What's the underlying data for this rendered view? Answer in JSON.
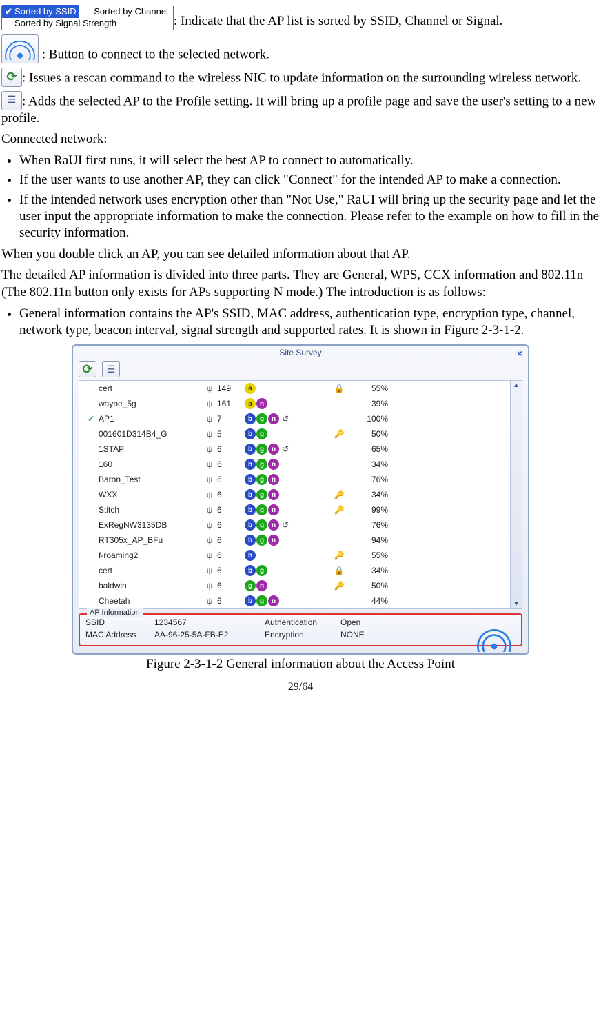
{
  "sort_dropdown": {
    "items": [
      "Sorted by SSID",
      "Sorted by Channel",
      "Sorted by Signal Strength"
    ],
    "selected_index": 0
  },
  "desc": {
    "sort": ": Indicate that the AP list is sorted by SSID, Channel or Signal.",
    "connect": " : Button to connect to the selected network.",
    "rescan": ": Issues a rescan command to the wireless NIC to update information on the surrounding wireless network.",
    "addprof": ": Adds the selected AP to the Profile setting. It will bring up a profile page and save the user's setting to a new profile."
  },
  "connected_heading": "Connected network:",
  "connected_bullets": [
    "When RaUI first runs, it will select the best AP to connect to automatically.",
    "If the user wants to use another AP, they can click \"Connect\" for the intended AP to make a connection.",
    "If the intended network uses encryption other than \"Not Use,\" RaUI will bring up the security page and let the user input the appropriate information to make the connection. Please refer to the example on how to fill in the security information."
  ],
  "p_dblclick": "When you double click an AP, you can see detailed information about that AP.",
  "p_detail_parts": "The detailed AP information is divided into three parts. They are General, WPS, CCX information and 802.11n (The 802.11n button only exists for APs supporting N mode.) The introduction is as follows:",
  "general_bullet": "General information contains the AP's SSID, MAC address, authentication type, encryption type, channel, network type, beacon interval, signal strength and supported rates. It is shown in Figure 2-3-1-2.",
  "site_survey": {
    "title": "Site Survey",
    "rows": [
      {
        "connected": "",
        "ssid": "cert",
        "chan": "149",
        "modes": [
          "a"
        ],
        "sec": "lock",
        "sig": "55%"
      },
      {
        "connected": "",
        "ssid": "wayne_5g",
        "chan": "161",
        "modes": [
          "a",
          "n"
        ],
        "sec": "",
        "sig": "39%"
      },
      {
        "connected": "✓",
        "ssid": "AP1",
        "chan": "7",
        "modes": [
          "b",
          "g",
          "n",
          "w"
        ],
        "sec": "",
        "sig": "100%"
      },
      {
        "connected": "",
        "ssid": "001601D314B4_G",
        "chan": "5",
        "modes": [
          "b",
          "g"
        ],
        "sec": "key",
        "sig": "50%"
      },
      {
        "connected": "",
        "ssid": "1STAP",
        "chan": "6",
        "modes": [
          "b",
          "g",
          "n",
          "w"
        ],
        "sec": "",
        "sig": "65%"
      },
      {
        "connected": "",
        "ssid": "160",
        "chan": "6",
        "modes": [
          "b",
          "g",
          "n"
        ],
        "sec": "",
        "sig": "34%"
      },
      {
        "connected": "",
        "ssid": "Baron_Test",
        "chan": "6",
        "modes": [
          "b",
          "g",
          "n"
        ],
        "sec": "",
        "sig": "76%"
      },
      {
        "connected": "",
        "ssid": "WXX",
        "chan": "6",
        "modes": [
          "b",
          "g",
          "n"
        ],
        "sec": "key",
        "sig": "34%"
      },
      {
        "connected": "",
        "ssid": "Stitch",
        "chan": "6",
        "modes": [
          "b",
          "g",
          "n"
        ],
        "sec": "key",
        "sig": "99%"
      },
      {
        "connected": "",
        "ssid": "ExRegNW3135DB",
        "chan": "6",
        "modes": [
          "b",
          "g",
          "n",
          "w"
        ],
        "sec": "",
        "sig": "76%"
      },
      {
        "connected": "",
        "ssid": "RT305x_AP_BFu",
        "chan": "6",
        "modes": [
          "b",
          "g",
          "n"
        ],
        "sec": "",
        "sig": "94%"
      },
      {
        "connected": "",
        "ssid": "f-roaming2",
        "chan": "6",
        "modes": [
          "b"
        ],
        "sec": "key",
        "sig": "55%"
      },
      {
        "connected": "",
        "ssid": "cert",
        "chan": "6",
        "modes": [
          "b",
          "g"
        ],
        "sec": "lock",
        "sig": "34%"
      },
      {
        "connected": "",
        "ssid": "baldwin",
        "chan": "6",
        "modes": [
          "g",
          "n"
        ],
        "sec": "key",
        "sig": "50%"
      },
      {
        "connected": "",
        "ssid": "Cheetah",
        "chan": "6",
        "modes": [
          "b",
          "g",
          "n"
        ],
        "sec": "",
        "sig": "44%"
      }
    ],
    "ap_info": {
      "legend": "AP Information",
      "ssid_label": "SSID",
      "ssid_val": "1234567",
      "auth_label": "Authentication",
      "auth_val": "Open",
      "mac_label": "MAC Address",
      "mac_val": "AA-96-25-5A-FB-E2",
      "enc_label": "Encryption",
      "enc_val": "NONE"
    }
  },
  "figure_caption": "Figure 2-3-1-2 General information about the Access Point",
  "page_number": "29/64"
}
